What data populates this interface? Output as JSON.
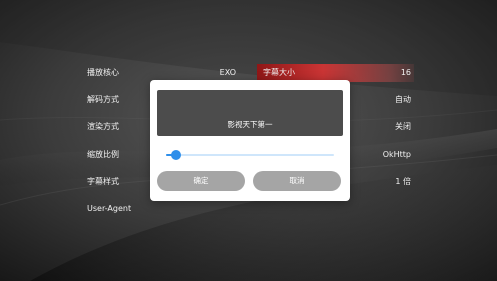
{
  "settings": {
    "rows": [
      {
        "left_label": "播放核心",
        "left_value": "EXO",
        "right_label": "字幕大小",
        "right_value": "16"
      },
      {
        "left_label": "解码方式",
        "left_value": "",
        "right_label": "",
        "right_value": "自动"
      },
      {
        "left_label": "渲染方式",
        "left_value": "",
        "right_label": "",
        "right_value": "关闭"
      },
      {
        "left_label": "缩放比例",
        "left_value": "",
        "right_label": "",
        "right_value": "OkHttp"
      },
      {
        "left_label": "字幕样式",
        "left_value": "",
        "right_label": "",
        "right_value": "1 倍"
      },
      {
        "left_label": "User-Agent",
        "left_value": "",
        "right_label": "",
        "right_value": ""
      }
    ]
  },
  "dialog": {
    "preview_text": "影视天下第一",
    "slider": {
      "value": 0.06
    },
    "confirm_label": "确定",
    "cancel_label": "取消"
  },
  "colors": {
    "accent": "#2f8fea",
    "active_row": "#d63434",
    "preview_bg": "#4c4c4c",
    "button_bg": "#a5a5a5"
  }
}
